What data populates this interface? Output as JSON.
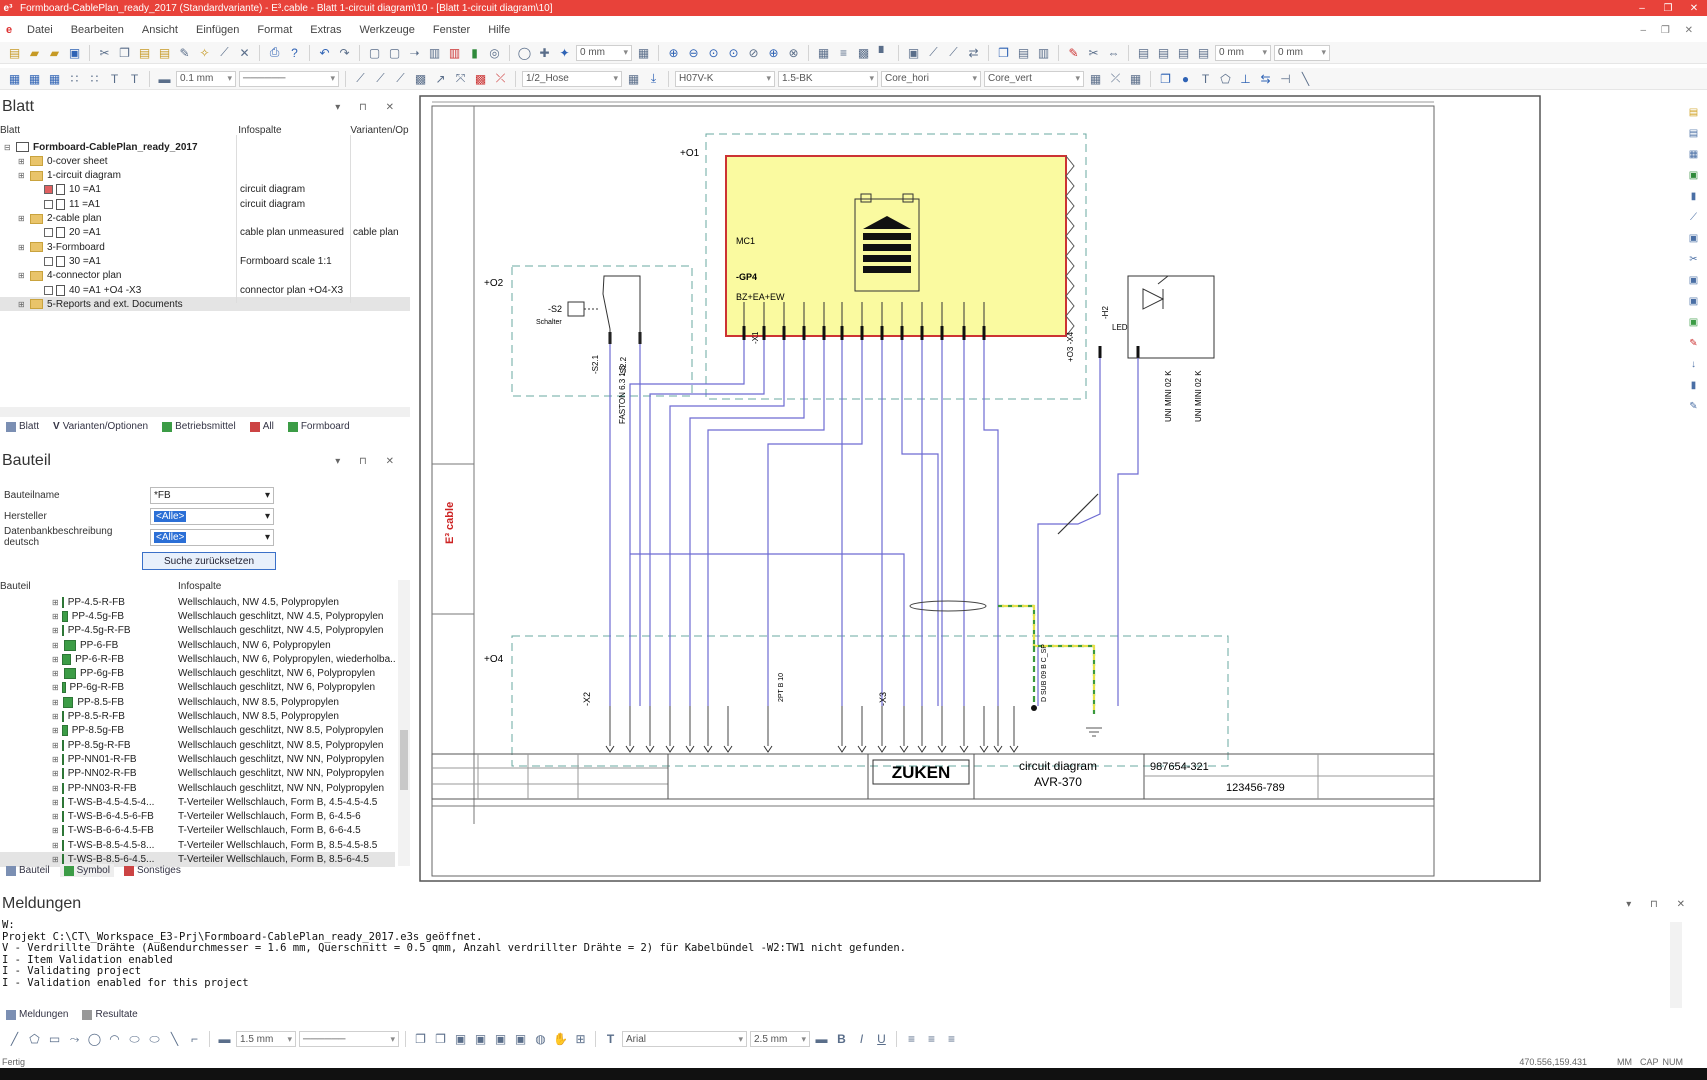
{
  "window": {
    "title": "Formboard-CablePlan_ready_2017 (Standardvariante) - E³.cable - Blatt 1-circuit diagram\\10 - [Blatt 1-circuit diagram\\10]",
    "app_logo": "e³",
    "controls": [
      "–",
      "❐",
      "✕"
    ]
  },
  "menu": {
    "items": [
      "Datei",
      "Bearbeiten",
      "Ansicht",
      "Einfügen",
      "Format",
      "Extras",
      "Werkzeuge",
      "Fenster",
      "Hilfe"
    ],
    "right": "– ❐ ✕"
  },
  "toolbar1": {
    "dim1": "0 mm",
    "dim2": "0 mm",
    "dim3": "0 mm"
  },
  "toolbar2": {
    "linewidth": "0.1 mm",
    "hose": "1/2_Hose",
    "wire_type": "H07V-K",
    "cross_section": "1.5-BK",
    "core_h": "Core_hori",
    "core_v": "Core_vert"
  },
  "blatt_panel": {
    "title": "Blatt",
    "columns": [
      "Blatt",
      "Infospalte",
      "Varianten/Op"
    ],
    "tree": [
      {
        "label": "Formboard-CablePlan_ready_2017",
        "info": "",
        "variant": "",
        "level": 0,
        "type": "project"
      },
      {
        "label": "0-cover sheet",
        "info": "",
        "variant": "",
        "level": 1,
        "type": "folder"
      },
      {
        "label": "1-circuit diagram",
        "info": "",
        "variant": "",
        "level": 1,
        "type": "folder"
      },
      {
        "label": "10 =A1",
        "info": "circuit diagram",
        "variant": "",
        "level": 2,
        "type": "sheet",
        "checked": true
      },
      {
        "label": "11 =A1",
        "info": "circuit diagram",
        "variant": "",
        "level": 2,
        "type": "sheet",
        "checked": false
      },
      {
        "label": "2-cable plan",
        "info": "",
        "variant": "",
        "level": 1,
        "type": "folder"
      },
      {
        "label": "20 =A1",
        "info": "cable plan unmeasured",
        "variant": "cable plan",
        "level": 2,
        "type": "sheet",
        "checked": false
      },
      {
        "label": "3-Formboard",
        "info": "",
        "variant": "",
        "level": 1,
        "type": "folder"
      },
      {
        "label": "30 =A1",
        "info": "Formboard scale 1:1",
        "variant": "",
        "level": 2,
        "type": "sheet",
        "checked": false
      },
      {
        "label": "4-connector plan",
        "info": "",
        "variant": "",
        "level": 1,
        "type": "folder"
      },
      {
        "label": "40 =A1 +O4 -X3",
        "info": "connector plan +O4-X3",
        "variant": "",
        "level": 2,
        "type": "sheet",
        "checked": false
      },
      {
        "label": "5-Reports and  ext. Documents",
        "info": "",
        "variant": "",
        "level": 1,
        "type": "folder"
      }
    ],
    "tabs": [
      "Blatt",
      "Varianten/Optionen",
      "Betriebsmittel",
      "All",
      "Formboard"
    ]
  },
  "bauteil_panel": {
    "title": "Bauteil",
    "fields": [
      {
        "label": "Bauteilname",
        "value": "*FB"
      },
      {
        "label": "Hersteller",
        "value": "<Alle>"
      },
      {
        "label": "Datenbankbeschreibung deutsch",
        "value": "<Alle>"
      }
    ],
    "reset_button": "Suche zurücksetzen",
    "columns": [
      "Bauteil",
      "Infospalte"
    ],
    "parts": [
      {
        "name": "PP-4.5-R-FB",
        "info": "Wellschlauch, NW 4.5, Polypropylen"
      },
      {
        "name": "PP-4.5g-FB",
        "info": "Wellschlauch geschlitzt, NW 4.5, Polypropylen"
      },
      {
        "name": "PP-4.5g-R-FB",
        "info": "Wellschlauch geschlitzt, NW 4.5, Polypropylen"
      },
      {
        "name": "PP-6-FB",
        "info": "Wellschlauch, NW 6, Polypropylen"
      },
      {
        "name": "PP-6-R-FB",
        "info": "Wellschlauch, NW 6, Polypropylen, wiederholba..."
      },
      {
        "name": "PP-6g-FB",
        "info": "Wellschlauch geschlitzt, NW 6, Polypropylen"
      },
      {
        "name": "PP-6g-R-FB",
        "info": "Wellschlauch geschlitzt, NW 6, Polypropylen"
      },
      {
        "name": "PP-8.5-FB",
        "info": "Wellschlauch, NW 8.5, Polypropylen"
      },
      {
        "name": "PP-8.5-R-FB",
        "info": "Wellschlauch, NW 8.5, Polypropylen"
      },
      {
        "name": "PP-8.5g-FB",
        "info": "Wellschlauch geschlitzt, NW 8.5, Polypropylen"
      },
      {
        "name": "PP-8.5g-R-FB",
        "info": "Wellschlauch geschlitzt, NW 8.5, Polypropylen"
      },
      {
        "name": "PP-NN01-R-FB",
        "info": "Wellschlauch geschlitzt, NW NN, Polypropylen"
      },
      {
        "name": "PP-NN02-R-FB",
        "info": "Wellschlauch geschlitzt, NW NN, Polypropylen"
      },
      {
        "name": "PP-NN03-R-FB",
        "info": "Wellschlauch geschlitzt, NW NN, Polypropylen"
      },
      {
        "name": "T-WS-B-4.5-4.5-4...",
        "info": "T-Verteiler Wellschlauch, Form B, 4.5-4.5-4.5"
      },
      {
        "name": "T-WS-B-6-4.5-6-FB",
        "info": "T-Verteiler Wellschlauch, Form B, 6-4.5-6"
      },
      {
        "name": "T-WS-B-6-6-4.5-FB",
        "info": "T-Verteiler Wellschlauch, Form B, 6-6-4.5"
      },
      {
        "name": "T-WS-B-8.5-4.5-8...",
        "info": "T-Verteiler Wellschlauch, Form B, 8.5-4.5-8.5"
      },
      {
        "name": "T-WS-B-8.5-6-4.5...",
        "info": "T-Verteiler Wellschlauch, Form B, 8.5-6-4.5"
      }
    ],
    "tabs": [
      "Bauteil",
      "Symbol",
      "Sonstiges"
    ]
  },
  "schematic": {
    "labels": {
      "o1": "+O1",
      "o2": "+O2",
      "o4": "+O4",
      "mc1": "MC1",
      "gp4": "-GP4",
      "bz": "BZ+EA+EW",
      "s2": "-S2",
      "schalter": "Schalter",
      "h2": "-H2",
      "led": "LED",
      "x1": "-X1",
      "x2": "-X2",
      "x3": "-X3",
      "faston": "FASTON 6.3 1.5",
      "uni1": "UNI MINI 02 K",
      "uni2": "UNI MINI 02 K",
      "dsub": "D SUB 09 B C_SP",
      "ipt": "2PT B 10"
    },
    "title_block": {
      "logo": "ZUKEN",
      "sheet_title": "circuit diagram",
      "sheet_sub": "AVR-370",
      "doc_no1": "987654-321",
      "doc_no2": "123456-789"
    }
  },
  "messages": {
    "title": "Meldungen",
    "lines": [
      "W:",
      "Projekt C:\\CT\\_Workspace_E3-Prj\\Formboard-CablePlan_ready_2017.e3s geöffnet.",
      "V - Verdrillte Drähte (Außendurchmesser = 1.6 mm, Querschnitt = 0.5 qmm, Anzahl verdrillter Drähte = 2) für Kabelbündel -W2:TW1 nicht gefunden.",
      "I - Item Validation enabled",
      "I - Validating project",
      "I - Validation enabled for this project"
    ],
    "tabs": [
      "Meldungen",
      "Resultate"
    ]
  },
  "bottom_toolbar": {
    "linewidth": "1.5 mm",
    "font": "Arial",
    "fontsize": "2.5 mm"
  },
  "status": {
    "left": "Fertig",
    "coords": "470.556,159.431",
    "unit": "MM",
    "caps": "CAP",
    "num": "NUM"
  }
}
